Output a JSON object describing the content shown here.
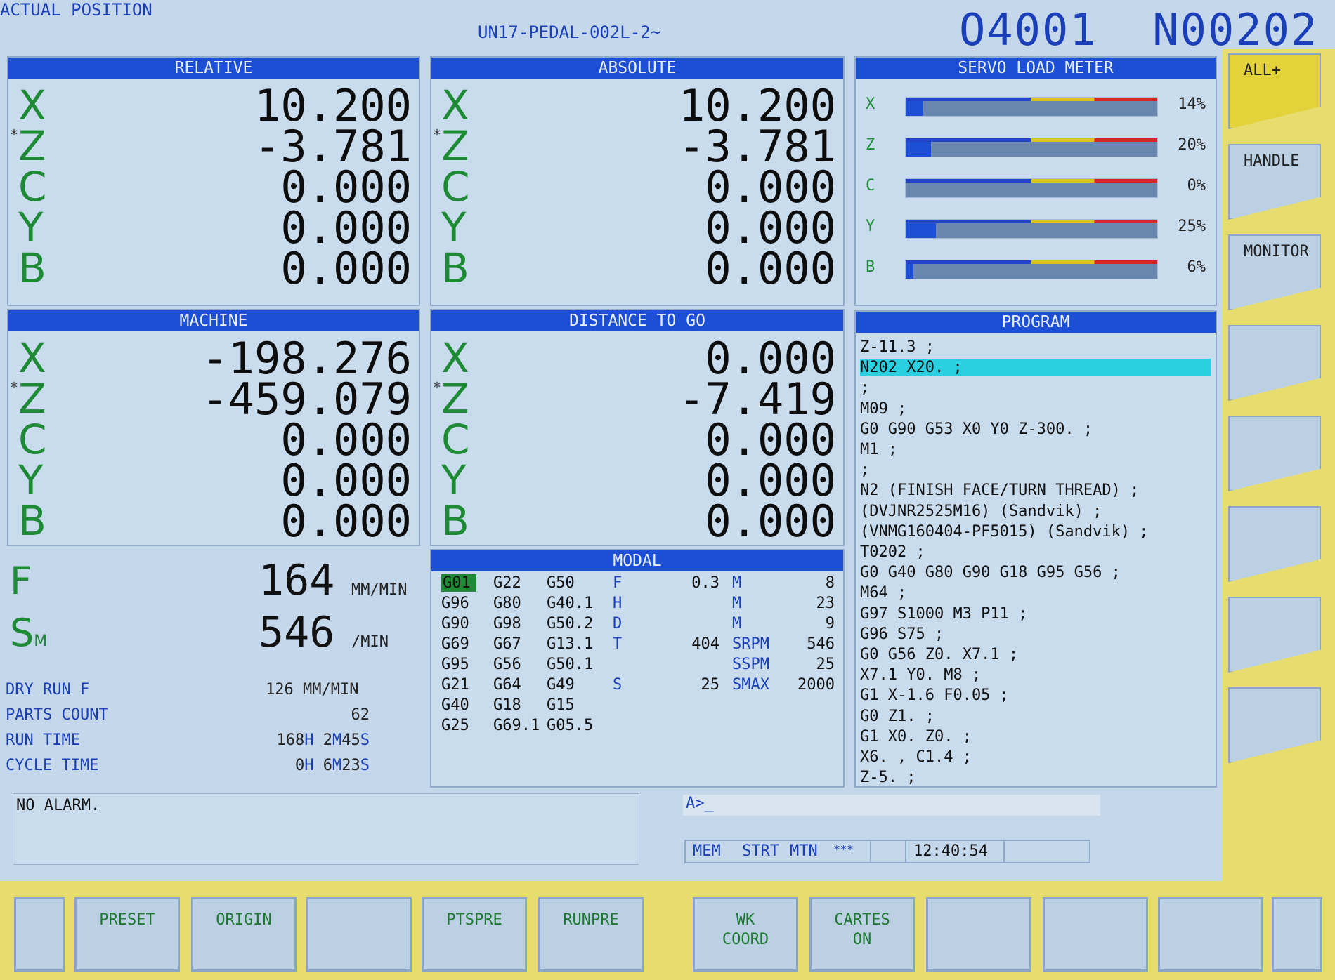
{
  "header": {
    "screen_title": "ACTUAL POSITION",
    "program_name": "UN17-PEDAL-002L-2~",
    "o_number": "O4001",
    "n_number": "N00202"
  },
  "relative": {
    "title": "RELATIVE",
    "axes": [
      {
        "name": "X",
        "value": "10.200",
        "star": ""
      },
      {
        "name": "Z",
        "value": "-3.781",
        "star": "*"
      },
      {
        "name": "C",
        "value": "0.000",
        "star": ""
      },
      {
        "name": "Y",
        "value": "0.000",
        "star": ""
      },
      {
        "name": "B",
        "value": "0.000",
        "star": ""
      }
    ]
  },
  "absolute": {
    "title": "ABSOLUTE",
    "axes": [
      {
        "name": "X",
        "value": "10.200",
        "star": ""
      },
      {
        "name": "Z",
        "value": "-3.781",
        "star": "*"
      },
      {
        "name": "C",
        "value": "0.000",
        "star": ""
      },
      {
        "name": "Y",
        "value": "0.000",
        "star": ""
      },
      {
        "name": "B",
        "value": "0.000",
        "star": ""
      }
    ]
  },
  "machine": {
    "title": "MACHINE",
    "axes": [
      {
        "name": "X",
        "value": "-198.276",
        "star": ""
      },
      {
        "name": "Z",
        "value": "-459.079",
        "star": "*"
      },
      {
        "name": "C",
        "value": "0.000",
        "star": ""
      },
      {
        "name": "Y",
        "value": "0.000",
        "star": ""
      },
      {
        "name": "B",
        "value": "0.000",
        "star": ""
      }
    ]
  },
  "distance": {
    "title": "DISTANCE TO GO",
    "axes": [
      {
        "name": "X",
        "value": "0.000",
        "star": ""
      },
      {
        "name": "Z",
        "value": "-7.419",
        "star": "*"
      },
      {
        "name": "C",
        "value": "0.000",
        "star": ""
      },
      {
        "name": "Y",
        "value": "0.000",
        "star": ""
      },
      {
        "name": "B",
        "value": "0.000",
        "star": ""
      }
    ]
  },
  "servo": {
    "title": "SERVO LOAD METER",
    "rows": [
      {
        "axis": "X",
        "percent_label": "14%",
        "fraction": 0.07
      },
      {
        "axis": "Z",
        "percent_label": "20%",
        "fraction": 0.1
      },
      {
        "axis": "C",
        "percent_label": "0%",
        "fraction": 0.0
      },
      {
        "axis": "Y",
        "percent_label": "25%",
        "fraction": 0.12
      },
      {
        "axis": "B",
        "percent_label": "6%",
        "fraction": 0.03
      }
    ]
  },
  "feed": {
    "label": "F",
    "value": "164",
    "unit": "MM/MIN"
  },
  "spindle": {
    "label": "S",
    "sub": "M",
    "value": "546",
    "unit": "/MIN"
  },
  "info": {
    "dry_run_label": "DRY RUN F",
    "dry_run_value": "126 MM/MIN",
    "parts_label": "PARTS COUNT",
    "parts_value": "62",
    "run_label": "RUN TIME",
    "run_h": "168",
    "run_m": "2",
    "run_s": "45",
    "cycle_label": "CYCLE TIME",
    "cycle_h": "0",
    "cycle_m": "6",
    "cycle_s": "23",
    "h": "H",
    "m": "M",
    "s": "S"
  },
  "modal": {
    "title": "MODAL",
    "gcodes": [
      [
        "G01",
        "G22",
        "G50"
      ],
      [
        "G96",
        "G80",
        "G40.1"
      ],
      [
        "G90",
        "G98",
        "G50.2"
      ],
      [
        "G69",
        "G67",
        "G13.1"
      ],
      [
        "G95",
        "G56",
        "G50.1"
      ],
      [
        "G21",
        "G64",
        "G49"
      ],
      [
        "G40",
        "G18",
        "G15"
      ],
      [
        "G25",
        "G69.1",
        "G05.5"
      ]
    ],
    "codes": [
      {
        "l1": "F",
        "v1": "0.3",
        "l2": "M",
        "v2": "8"
      },
      {
        "l1": "H",
        "v1": "",
        "l2": "M",
        "v2": "23"
      },
      {
        "l1": "D",
        "v1": "",
        "l2": "M",
        "v2": "9"
      },
      {
        "l1": "T",
        "v1": "404",
        "l2": "SRPM",
        "v2": "546"
      },
      {
        "l1": "",
        "v1": "",
        "l2": "SSPM",
        "v2": "25"
      },
      {
        "l1": "S",
        "v1": "25",
        "l2": "SMAX",
        "v2": "2000"
      }
    ]
  },
  "program": {
    "title": "PROGRAM",
    "lines": [
      "Z-11.3 ;",
      "N202 X20. ;",
      ";",
      "M09 ;",
      "G0 G90 G53 X0 Y0 Z-300. ;",
      "M1 ;",
      ";",
      "N2 (FINISH FACE/TURN THREAD) ;",
      "(DVJNR2525M16) (Sandvik) ;",
      "(VNMG160404-PF5015) (Sandvik) ;",
      "T0202 ;",
      "G0 G40 G80 G90 G18 G95 G56 ;",
      "M64 ;",
      "G97 S1000 M3 P11 ;",
      "G96 S75 ;",
      "G0 G56 Z0. X7.1 ;",
      "X7.1 Y0. M8 ;",
      "G1 X-1.6 F0.05 ;",
      "G0 Z1. ;",
      "G1 X0. Z0. ;",
      "X6. , C1.4 ;",
      "Z-5. ;"
    ],
    "highlight_index": 1
  },
  "alarm": {
    "text": "NO ALARM."
  },
  "input": {
    "prompt": "A>_"
  },
  "status": {
    "mode": "MEM",
    "state": "STRT",
    "motion": "MTN",
    "flag": "***",
    "time": "12:40:54"
  },
  "softkeys": [
    "",
    "PRESET",
    "ORIGIN",
    "",
    "PTSPRE",
    "RUNPRE",
    "WK COORD",
    "CARTES ON",
    "",
    "",
    "",
    ""
  ],
  "rightkeys": [
    "ALL+",
    "HANDLE",
    "MONITOR",
    "",
    "",
    "",
    "",
    ""
  ],
  "colors": {
    "title_bar": "#1c4fd6",
    "axis_green": "#1e8a35",
    "panel_bg": "#c9dcee",
    "highlight": "#2ad0e0",
    "frame_yellow": "#e7dd6e"
  }
}
